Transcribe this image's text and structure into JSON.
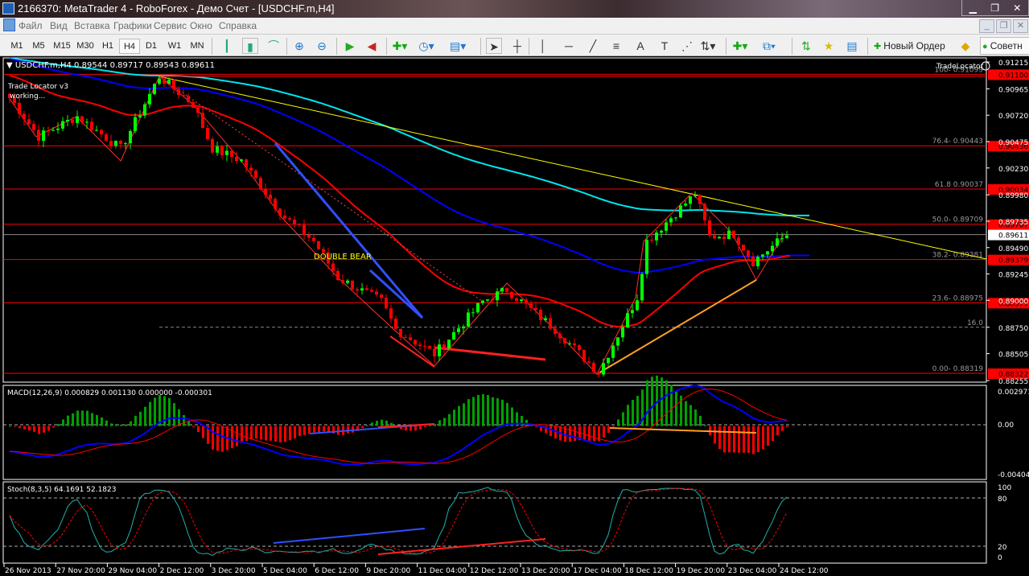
{
  "window": {
    "title": "2166370: MetaTrader 4 - RoboForex - Демо Счет - [USDCHF.m,H4]",
    "minimize": "▁",
    "restore": "❐",
    "close": "✕"
  },
  "menu": [
    "Файл",
    "Вид",
    "Вставка",
    "Графики",
    "Сервис",
    "Окно",
    "Справка"
  ],
  "toolbar": {
    "timeframes": [
      "M1",
      "M5",
      "M15",
      "M30",
      "H1",
      "H4",
      "D1",
      "W1",
      "MN"
    ],
    "active_timeframe": "H4",
    "new_order": "Новый Ордер",
    "advisors": "Советн"
  },
  "chart": {
    "header": "USDCHF.m,H4  0.89544 0.89717 0.89543 0.89611",
    "indicator_text": [
      "Trade Locator v3",
      "working..."
    ],
    "tradelocator_label": "TradeLocator",
    "pattern_label": "DOUBLE BEAR",
    "current_price": "0.89611",
    "current_price_value": 0.89611,
    "price_range": [
      0.88255,
      0.91215
    ],
    "price_ticks": [
      "0.91215",
      "0.90965",
      "0.90720",
      "0.90475",
      "0.90230",
      "0.89980",
      "0.89735",
      "0.89490",
      "0.89245",
      "0.89000",
      "0.88750",
      "0.88505",
      "0.88255"
    ],
    "fib_levels": [
      {
        "label": "100- 0.91099",
        "price": 0.911,
        "tag": "0.91100"
      },
      {
        "label": "76.4- 0.90443",
        "price": 0.90436,
        "tag": "0.90436"
      },
      {
        "label": "61.8 0.90037",
        "price": 0.90034,
        "tag": "0.90034"
      },
      {
        "label": "50.0- 0.89709",
        "price": 0.89707,
        "tag": "0.89707"
      },
      {
        "label": "38.2- 0.89381",
        "price": 0.89379,
        "tag": "0.89379"
      },
      {
        "label": "23.6- 0.88975",
        "price": 0.88977,
        "tag": "0.88977"
      },
      {
        "label": "0.00- 0.88319",
        "price": 0.88322,
        "tag": "0.88322"
      }
    ],
    "level_16": {
      "label": "16.0",
      "price": 0.8875
    },
    "close_waypoints": [
      [
        0,
        0.9089
      ],
      [
        6,
        0.9052
      ],
      [
        14,
        0.9071
      ],
      [
        23,
        0.9041
      ],
      [
        31,
        0.9108
      ],
      [
        38,
        0.9082
      ],
      [
        42,
        0.9041
      ],
      [
        48,
        0.903
      ],
      [
        57,
        0.8977
      ],
      [
        63,
        0.8955
      ],
      [
        68,
        0.8921
      ],
      [
        77,
        0.8899
      ],
      [
        80,
        0.8873
      ],
      [
        88,
        0.885
      ],
      [
        98,
        0.8899
      ],
      [
        103,
        0.891
      ],
      [
        113,
        0.8873
      ],
      [
        122,
        0.8833
      ],
      [
        130,
        0.8903
      ],
      [
        132,
        0.8955
      ],
      [
        137,
        0.8977
      ],
      [
        142,
        0.8999
      ],
      [
        145,
        0.8959
      ],
      [
        150,
        0.8962
      ],
      [
        154,
        0.8936
      ],
      [
        161,
        0.8961
      ]
    ],
    "colors": {
      "bull": "#00ff00",
      "bear": "#ff0000",
      "fib": "#ff0000",
      "ma_fast": "#ff0000",
      "ma_mid": "#0000ff",
      "ma_slow": "#00e5ee"
    }
  },
  "macd": {
    "header": "MACD(12,26,9) 0.000829 0.001130 0.000000 -0.000301",
    "ticks": [
      "0.002971",
      "0.00",
      "-0.004043"
    ],
    "range": [
      -0.004043,
      0.002971
    ]
  },
  "stoch": {
    "header": "Stoch(8,3,5) 64.1691 52.1823",
    "ticks": [
      "100",
      "80",
      "20",
      "0"
    ]
  },
  "time_labels": [
    "26 Nov 2013",
    "27 Nov 20:00",
    "29 Nov 04:00",
    "2 Dec 12:00",
    "3 Dec 20:00",
    "5 Dec 04:00",
    "6 Dec 12:00",
    "9 Dec 20:00",
    "11 Dec 04:00",
    "12 Dec 12:00",
    "13 Dec 20:00",
    "17 Dec 04:00",
    "18 Dec 12:00",
    "19 Dec 20:00",
    "23 Dec 04:00",
    "24 Dec 12:00"
  ]
}
